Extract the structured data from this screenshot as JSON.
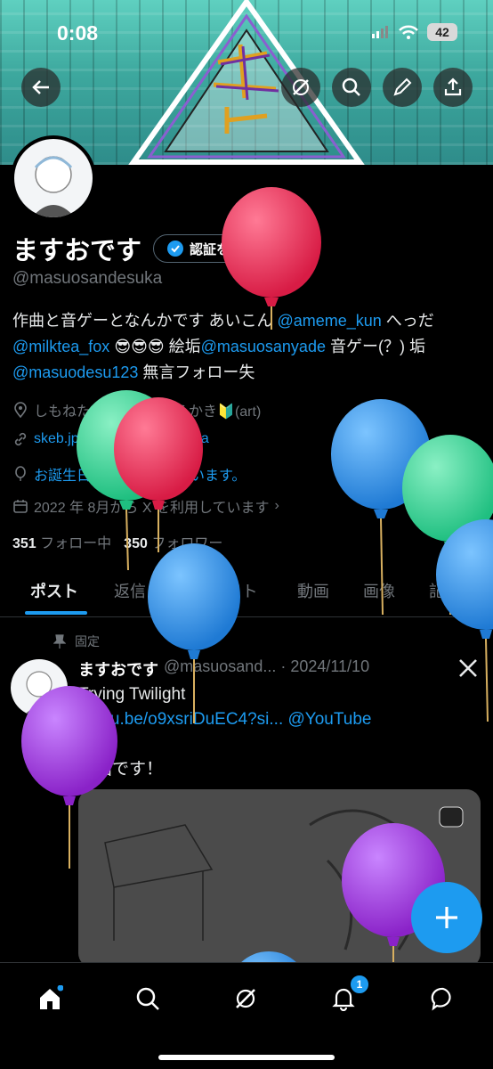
{
  "status_bar": {
    "time": "0:08",
    "battery": "42"
  },
  "profile": {
    "display_name": "ますおです",
    "verify_label": "認証を受ける",
    "handle": "@masuosandesuka",
    "bio": {
      "p1": "作曲と音ゲーとなんかです あいこん ",
      "m1": "@ameme_kun",
      "p2": " へっだ ",
      "m2": "@milktea_fox",
      "p3": " 😎😎😎 絵垢",
      "m3": "@masuosanyade",
      "p4": " 音ゲー(？) 垢 ",
      "m4": "@masuodesu123",
      "p5": " 無言フォロー失"
    },
    "location": "しもねたちゃん",
    "category": "おえかき🔰(art)",
    "website": "skeb.jp/@masuosandesuka",
    "birthday": "お誕生日おめでとうございます。",
    "joined": "2022 年 8月から X を利用しています",
    "following_count": "351",
    "following_label": "フォロー中",
    "followers_count": "350",
    "followers_label": "フォロワー"
  },
  "tabs": [
    "ポスト",
    "返信",
    "ハイライト",
    "動画",
    "画像",
    "記事"
  ],
  "post": {
    "pinned_label": "固定",
    "author": "ますおです",
    "handle_date": "@masuosand... · 2024/11/10",
    "line1": "Trying Twilight",
    "link": "youtu.be/o9xsriDuEC4?si...",
    "link_mention": "@YouTube",
    "line2": "新曲です！"
  },
  "nav": {
    "notification_badge": "1"
  },
  "colors": {
    "accent": "#1d9bf0",
    "background": "#000000",
    "balloon_red": "#e0234e",
    "balloon_blue": "#2b8fe0",
    "balloon_green": "#2fd693",
    "balloon_purple": "#9a2fd6"
  }
}
